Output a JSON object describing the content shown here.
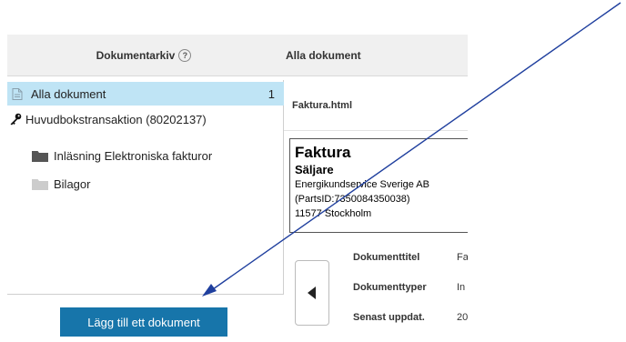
{
  "header": {
    "archive_title": "Dokumentarkiv",
    "help_symbol": "?",
    "current_view": "Alla dokument"
  },
  "tree": {
    "all_documents": {
      "label": "Alla dokument",
      "count": "1"
    },
    "transaction": {
      "label": "Huvudbokstransaktion (80202137)"
    },
    "folders": [
      {
        "label": "Inläsning Elektroniska fakturor"
      },
      {
        "label": "Bilagor"
      }
    ]
  },
  "document": {
    "filename": "Faktura.html",
    "preview": {
      "title": "Faktura",
      "subtitle": "Säljare",
      "lines": [
        "Energikundservice Sverige AB",
        "(PartsID:7350084350038)",
        "11577 Stockholm"
      ]
    },
    "meta": [
      {
        "label": "Dokumenttitel",
        "value": "Fa"
      },
      {
        "label": "Dokumenttyper",
        "value": "In"
      },
      {
        "label": "Senast uppdat.",
        "value": "20"
      }
    ]
  },
  "actions": {
    "add_document": "Lägg till ett dokument"
  },
  "colors": {
    "selected_row": "#bfe4f5",
    "button": "#1775aa",
    "annotation_arrow": "#1f3f9e",
    "folder_dark": "#555555",
    "folder_light": "#cccccc"
  }
}
